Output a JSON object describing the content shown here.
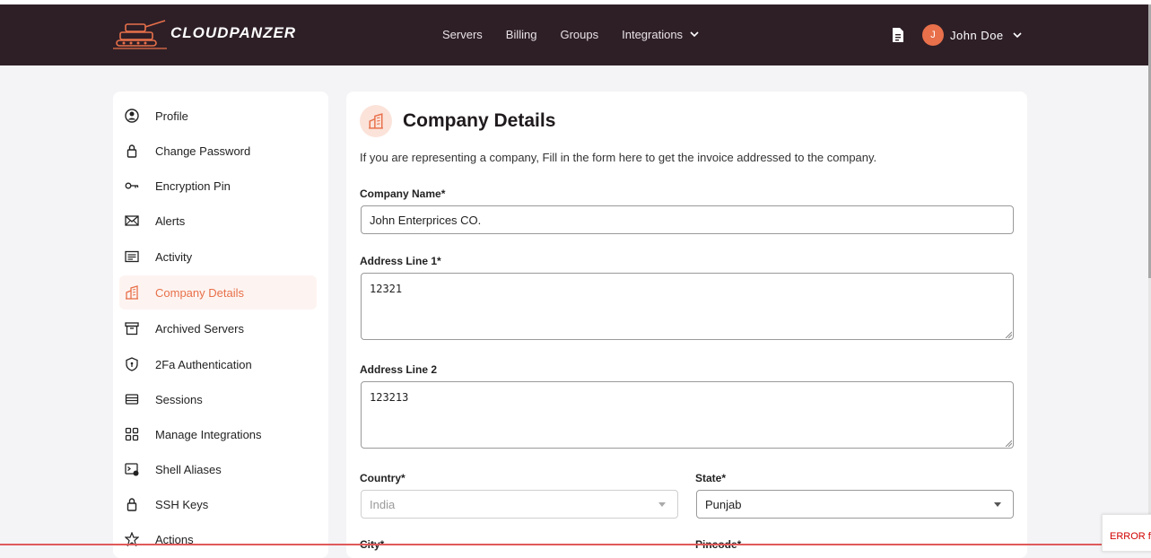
{
  "brand": {
    "name": "CLOUDPANZER"
  },
  "nav": {
    "links": [
      "Servers",
      "Billing",
      "Groups"
    ],
    "integrations_label": "Integrations"
  },
  "user": {
    "initial": "J",
    "name": "John Doe"
  },
  "sidebar": {
    "items": [
      {
        "label": "Profile",
        "icon": "profile-icon"
      },
      {
        "label": "Change Password",
        "icon": "lock-icon"
      },
      {
        "label": "Encryption Pin",
        "icon": "key-icon"
      },
      {
        "label": "Alerts",
        "icon": "mail-icon"
      },
      {
        "label": "Activity",
        "icon": "list-icon"
      },
      {
        "label": "Company Details",
        "icon": "building-icon",
        "active": true
      },
      {
        "label": "Archived Servers",
        "icon": "archive-icon"
      },
      {
        "label": "2Fa Authentication",
        "icon": "shield-icon"
      },
      {
        "label": "Sessions",
        "icon": "sessions-icon"
      },
      {
        "label": "Manage Integrations",
        "icon": "grid-icon"
      },
      {
        "label": "Shell Aliases",
        "icon": "terminal-icon"
      },
      {
        "label": "SSH Keys",
        "icon": "lock-icon"
      },
      {
        "label": "Actions",
        "icon": "star-icon"
      }
    ]
  },
  "company": {
    "title": "Company Details",
    "description": "If you are representing a company, Fill in the form here to get the invoice addressed to the company.",
    "name_label": "Company Name*",
    "name_value": "John Enterprices CO.",
    "addr1_label": "Address Line 1*",
    "addr1_value": "12321",
    "addr2_label": "Address Line 2",
    "addr2_value": "123213",
    "country_label": "Country*",
    "country_value": "India",
    "state_label": "State*",
    "state_value": "Punjab",
    "city_label": "City*",
    "pincode_label": "Pincode*"
  },
  "error": {
    "text": "ERROR for"
  },
  "colors": {
    "accent": "#e8704a",
    "navbar": "#2e1f27"
  }
}
